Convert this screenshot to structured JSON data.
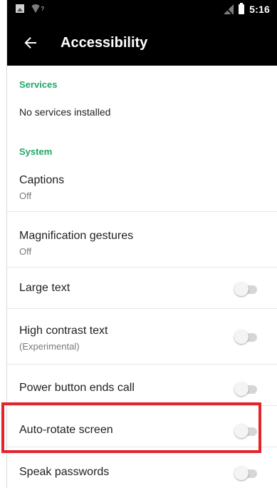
{
  "status_bar": {
    "time": "5:16",
    "icons": [
      "image-notification-icon",
      "wifi-unknown-icon",
      "no-signal-icon",
      "battery-icon"
    ],
    "wifi_badge": "?"
  },
  "toolbar": {
    "back_icon": "arrow-back-icon",
    "title": "Accessibility"
  },
  "sections": {
    "services": {
      "header": "Services",
      "empty_text": "No services installed"
    },
    "system": {
      "header": "System"
    }
  },
  "preferences": [
    {
      "title": "Captions",
      "summary": "Off"
    },
    {
      "title": "Magnification gestures",
      "summary": "Off"
    },
    {
      "title": "Large text",
      "toggle": false
    },
    {
      "title": "High contrast text",
      "summary": "(Experimental)",
      "toggle": false
    },
    {
      "title": "Power button ends call",
      "toggle": false
    },
    {
      "title": "Auto-rotate screen",
      "toggle": false,
      "highlighted": true
    },
    {
      "title": "Speak passwords",
      "toggle": false
    }
  ],
  "colors": {
    "accent": "#22a867",
    "app_bar": "#000000",
    "highlight": "#e3242b"
  }
}
